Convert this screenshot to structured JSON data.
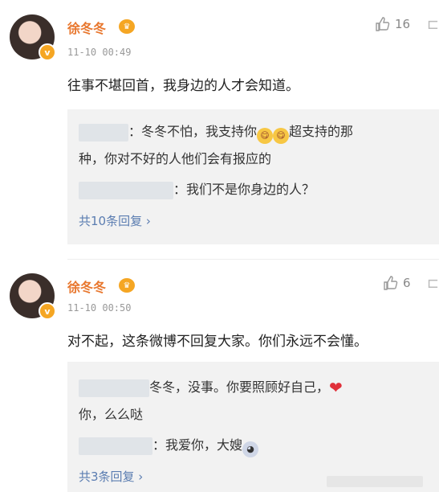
{
  "comments": [
    {
      "username": "徐冬冬",
      "time": "11-10 00:49",
      "likes": "16",
      "text": "往事不堪回首，我身边的人才会知道。",
      "replies": [
        {
          "line1": "：冬冬不怕，我支持你",
          "line1b": "超支持的那",
          "line2": "种，你对不好的人他们会有报应的"
        },
        {
          "line1": "：我们不是你身边的人？"
        }
      ],
      "more": "共10条回复 ›"
    },
    {
      "username": "徐冬冬",
      "time": "11-10 00:50",
      "likes": "6",
      "text": "对不起，这条微博不回复大家。你们永远不会懂。",
      "replies": [
        {
          "line1": "冬冬，没事。你要照顾好自己，",
          "line2": "你，么么哒"
        },
        {
          "line1": "：我爱你，大嫂"
        }
      ],
      "more": "共3条回复 ›"
    }
  ],
  "icons": {
    "verified": "verified-badge-icon",
    "crown": "crown-icon",
    "like": "thumbs-up-icon",
    "heart": "heart-icon",
    "emoji": "emoji-icon"
  },
  "colors": {
    "username": "#e8772e",
    "link": "#5b7db1",
    "reply_bg": "#f2f2f2"
  }
}
